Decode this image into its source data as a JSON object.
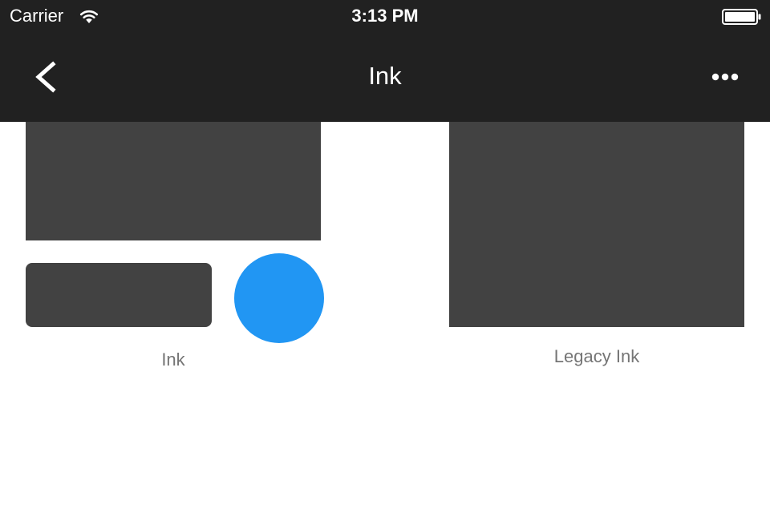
{
  "status_bar": {
    "carrier": "Carrier",
    "time": "3:13 PM",
    "wifi_icon": "wifi-icon",
    "battery_icon": "battery-full-icon"
  },
  "nav_bar": {
    "title": "Ink",
    "back_icon": "chevron-left-icon",
    "more_icon": "more-horizontal-icon"
  },
  "ink_demo": {
    "caption": "Ink"
  },
  "legacy_ink_demo": {
    "caption": "Legacy Ink"
  },
  "colors": {
    "app_bar": "#212121",
    "surface": "#424242",
    "accent": "#2196F3",
    "caption_text": "#757575",
    "background": "#FFFFFF"
  }
}
